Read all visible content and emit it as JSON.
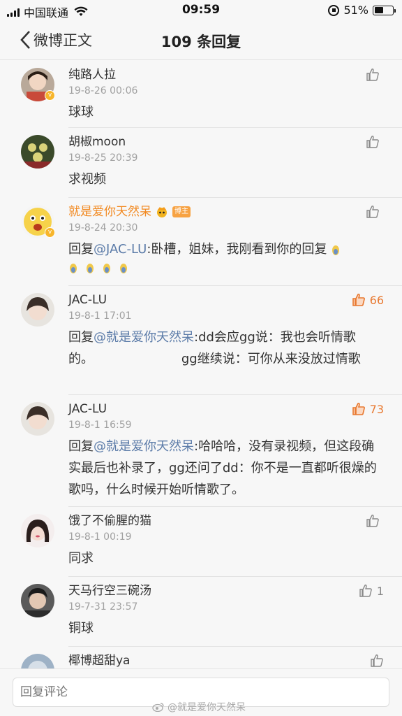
{
  "status_bar": {
    "carrier": "中国联通",
    "time": "09:59",
    "battery": "51%",
    "battery_level": 0.51
  },
  "nav": {
    "back_label": "微博正文",
    "title": "109 条回复"
  },
  "comments": [
    {
      "user": "纯路人拉",
      "time": "19-8-26 00:06",
      "text": "球球",
      "likes": ""
    },
    {
      "user": "胡椒moon",
      "time": "19-8-25 20:39",
      "text": "求视频",
      "likes": ""
    },
    {
      "user": "就是爱你天然呆",
      "badge": "博主",
      "time": "19-8-24 20:30",
      "reply_prefix": "回复",
      "mention": "@JAC-LU",
      "text": ":卧槽，姐妹，我刚看到你的回复",
      "likes": ""
    },
    {
      "user": "JAC-LU",
      "time": "19-8-1 17:01",
      "reply_prefix": "回复",
      "mention": "@就是爱你天然呆",
      "text": ":dd会应gg说：我也会听情歌的。                      gg继续说：可你从来没放过情歌",
      "likes": "66"
    },
    {
      "user": "JAC-LU",
      "time": "19-8-1 16:59",
      "reply_prefix": "回复",
      "mention": "@就是爱你天然呆",
      "text": ":哈哈哈，没有录视频，但这段确实最后也补录了，gg还问了dd：你不是一直都听很燥的歌吗，什么时候开始听情歌了。",
      "likes": "73"
    },
    {
      "user": "饿了不偷腥的猫",
      "time": "19-8-1 00:19",
      "text": "同求",
      "likes": ""
    },
    {
      "user": "天马行空三碗汤",
      "time": "19-7-31 23:57",
      "text": "铜球",
      "likes": "1"
    },
    {
      "user": "椰博超甜ya",
      "time": "",
      "text": "",
      "likes": ""
    }
  ],
  "bottom": {
    "placeholder": "回复评论",
    "watermark": "@就是爱你天然呆"
  },
  "colors": {
    "accent": "#f28a22",
    "mention": "#5b7ba8",
    "hot_like": "#e8782f"
  },
  "icons": [
    "signal-icon",
    "wifi-icon",
    "rotation-lock-icon",
    "battery-icon",
    "chevron-left-icon",
    "thumbs-up-icon",
    "verified-badge-icon",
    "crown-icon",
    "weibo-logo-icon"
  ]
}
